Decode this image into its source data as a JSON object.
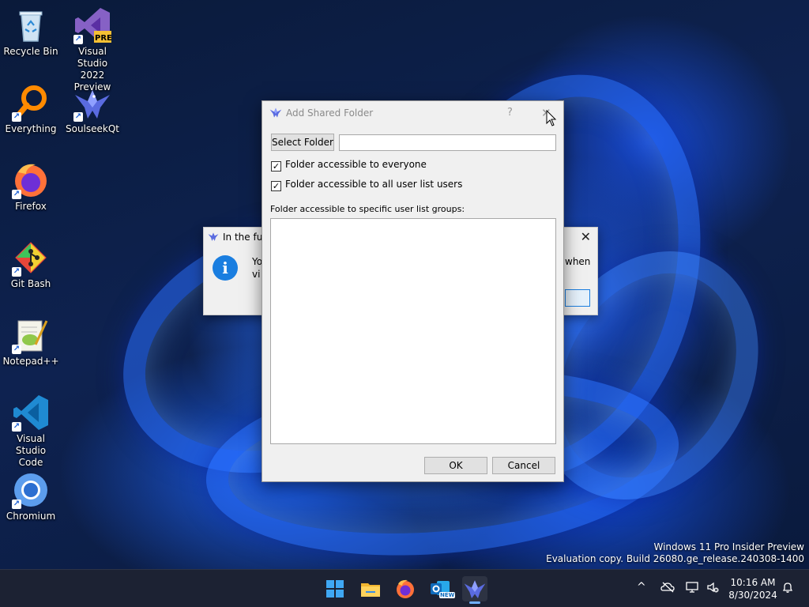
{
  "desktop_icons": [
    {
      "id": "recycle-bin",
      "label_lines": [
        "Recycle Bin"
      ],
      "shortcut": false
    },
    {
      "id": "visual-studio-2022",
      "label_lines": [
        "Visual Studio",
        "2022 Preview"
      ],
      "shortcut": true,
      "badge": "PRE"
    },
    {
      "id": "everything",
      "label_lines": [
        "Everything"
      ],
      "shortcut": true
    },
    {
      "id": "soulseekqt",
      "label_lines": [
        "SoulseekQt"
      ],
      "shortcut": true
    },
    {
      "id": "firefox",
      "label_lines": [
        "Firefox"
      ],
      "shortcut": true
    },
    {
      "id": "git-bash",
      "label_lines": [
        "Git Bash"
      ],
      "shortcut": true
    },
    {
      "id": "notepad-plus-plus",
      "label_lines": [
        "Notepad++"
      ],
      "shortcut": true
    },
    {
      "id": "vscode",
      "label_lines": [
        "Visual Studio",
        "Code"
      ],
      "shortcut": true
    },
    {
      "id": "chromium",
      "label_lines": [
        "Chromium"
      ],
      "shortcut": true
    }
  ],
  "shortcut_glyph": "↗",
  "info_dialog": {
    "title_fragment": "In the futu",
    "close_glyph": "✕",
    "icon_glyph": "i",
    "text_fragment_1": "Yo",
    "text_fragment_2": "vi",
    "text_fragment_right": "when"
  },
  "main_dialog": {
    "title": "Add Shared Folder",
    "help_glyph": "?",
    "close_glyph": "✕",
    "select_folder_label": "Select Folder",
    "folder_path_value": "",
    "checkbox_everyone": {
      "label": "Folder accessible to everyone",
      "checked": true
    },
    "checkbox_all_users": {
      "label": "Folder accessible to all user list users",
      "checked": true
    },
    "groups_label": "Folder accessible to specific user list groups:",
    "check_glyph": "✓",
    "ok_label": "OK",
    "cancel_label": "Cancel"
  },
  "watermark": {
    "line1": "Windows 11 Pro Insider Preview",
    "line2": "Evaluation copy. Build 26080.ge_release.240308-1400"
  },
  "taskbar": {
    "items": [
      "start",
      "file-explorer",
      "firefox",
      "outlook-new",
      "soulseekqt"
    ],
    "active_item": "soulseekqt",
    "outlook_badge": "NEW",
    "tray_chevron": "^",
    "time": "10:16 AM",
    "date": "8/30/2024"
  },
  "colors": {
    "accent": "#1a7ee0",
    "taskbar_bg": "#1c2233",
    "dialog_bg": "#f0f0f0"
  }
}
